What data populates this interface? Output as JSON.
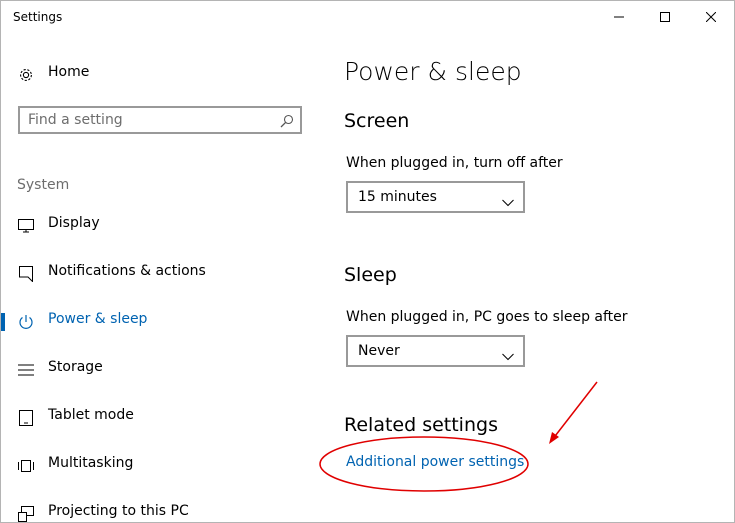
{
  "window": {
    "title": "Settings"
  },
  "sidebar": {
    "home_label": "Home",
    "search_placeholder": "Find a setting",
    "section_label": "System",
    "items": [
      {
        "label": "Display",
        "icon": "display-icon",
        "active": false
      },
      {
        "label": "Notifications & actions",
        "icon": "notifications-icon",
        "active": false
      },
      {
        "label": "Power & sleep",
        "icon": "power-icon",
        "active": true
      },
      {
        "label": "Storage",
        "icon": "storage-icon",
        "active": false
      },
      {
        "label": "Tablet mode",
        "icon": "tablet-mode-icon",
        "active": false
      },
      {
        "label": "Multitasking",
        "icon": "multitasking-icon",
        "active": false
      },
      {
        "label": "Projecting to this PC",
        "icon": "projecting-icon",
        "active": false
      }
    ]
  },
  "main": {
    "page_title": "Power & sleep",
    "screen": {
      "heading": "Screen",
      "label": "When plugged in, turn off after",
      "value": "15 minutes"
    },
    "sleep": {
      "heading": "Sleep",
      "label": "When plugged in, PC goes to sleep after",
      "value": "Never"
    },
    "related": {
      "heading": "Related settings",
      "link": "Additional power settings"
    }
  },
  "colors": {
    "accent": "#0063b1",
    "annotation": "#e00000"
  }
}
